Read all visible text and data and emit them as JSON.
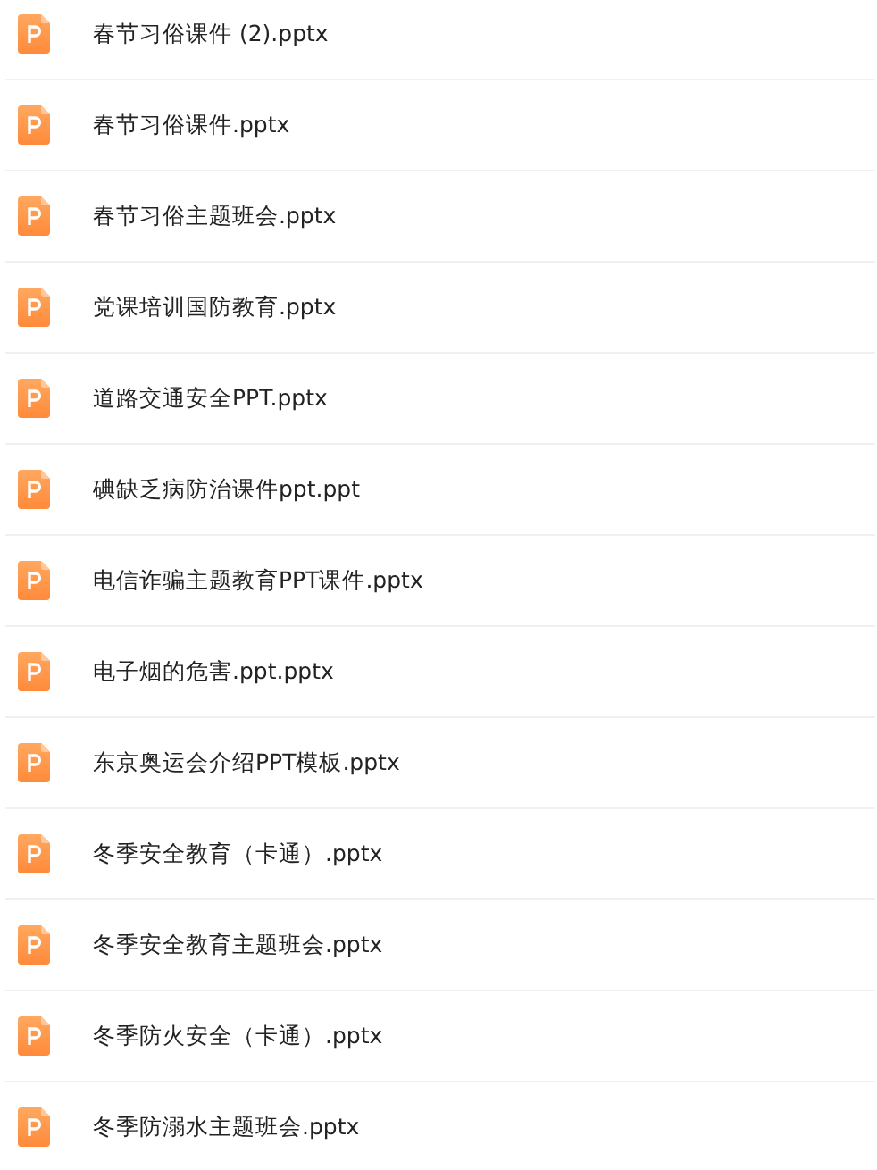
{
  "files": [
    {
      "name": "春节习俗课件 (2).pptx"
    },
    {
      "name": "春节习俗课件.pptx"
    },
    {
      "name": "春节习俗主题班会.pptx"
    },
    {
      "name": "党课培训国防教育.pptx"
    },
    {
      "name": "道路交通安全PPT.pptx"
    },
    {
      "name": "碘缺乏病防治课件ppt.ppt"
    },
    {
      "name": "电信诈骗主题教育PPT课件.pptx"
    },
    {
      "name": "电子烟的危害.ppt.pptx"
    },
    {
      "name": "东京奥运会介绍PPT模板.pptx"
    },
    {
      "name": "冬季安全教育（卡通）.pptx"
    },
    {
      "name": "冬季安全教育主题班会.pptx"
    },
    {
      "name": "冬季防火安全（卡通）.pptx"
    },
    {
      "name": "冬季防溺水主题班会.pptx"
    }
  ]
}
